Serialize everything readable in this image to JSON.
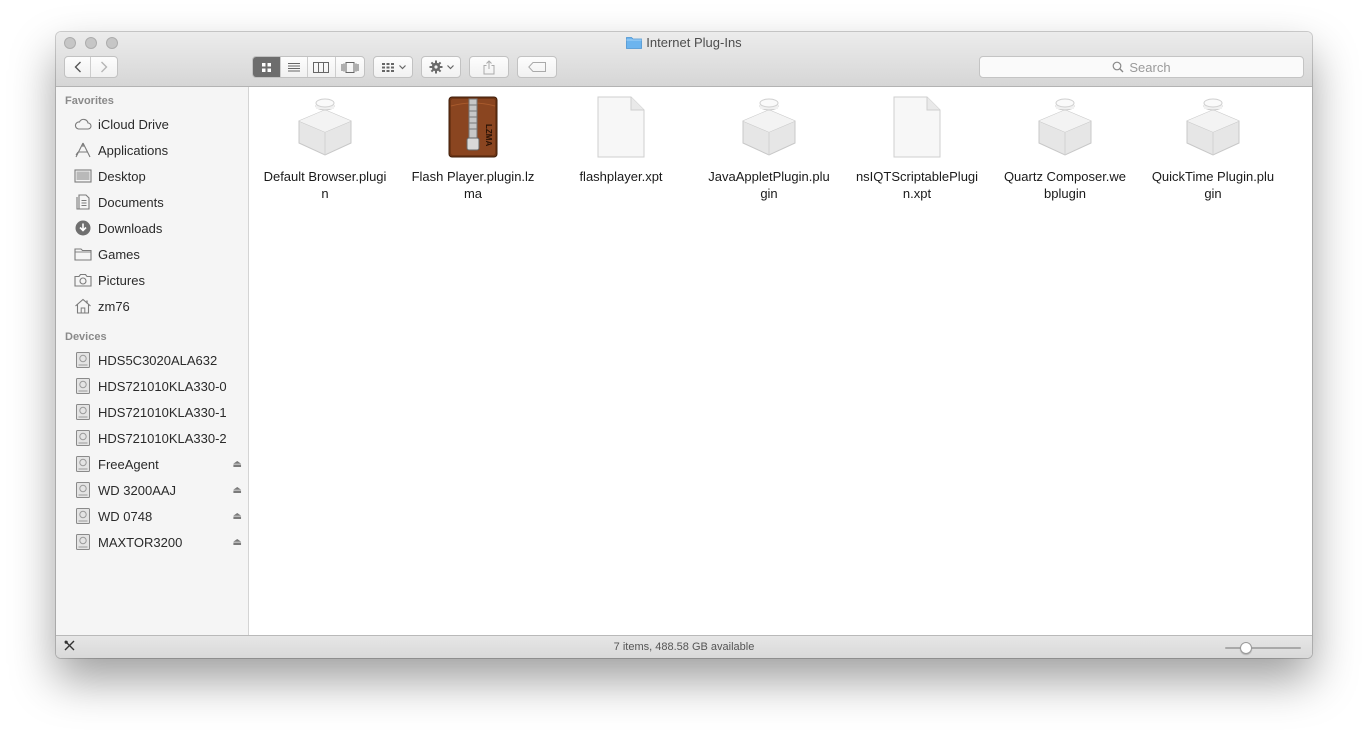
{
  "window": {
    "title": "Internet Plug-Ins",
    "search_placeholder": "Search"
  },
  "sidebar": {
    "favorites_header": "Favorites",
    "favorites": [
      {
        "label": "iCloud Drive",
        "icon": "cloud-icon"
      },
      {
        "label": "Applications",
        "icon": "applications-icon"
      },
      {
        "label": "Desktop",
        "icon": "desktop-icon"
      },
      {
        "label": "Documents",
        "icon": "documents-icon"
      },
      {
        "label": "Downloads",
        "icon": "downloads-icon"
      },
      {
        "label": "Games",
        "icon": "folder-icon"
      },
      {
        "label": "Pictures",
        "icon": "camera-icon"
      },
      {
        "label": "zm76",
        "icon": "home-icon"
      }
    ],
    "devices_header": "Devices",
    "devices": [
      {
        "label": "HDS5C3020ALA632",
        "ejectable": false
      },
      {
        "label": "HDS721010KLA330-0",
        "ejectable": false
      },
      {
        "label": "HDS721010KLA330-1",
        "ejectable": false
      },
      {
        "label": "HDS721010KLA330-2",
        "ejectable": false
      },
      {
        "label": "FreeAgent",
        "ejectable": true
      },
      {
        "label": "WD 3200AAJ",
        "ejectable": true
      },
      {
        "label": "WD 0748",
        "ejectable": true
      },
      {
        "label": "MAXTOR3200",
        "ejectable": true
      }
    ]
  },
  "files": [
    {
      "name": "Default Browser.plugin",
      "icon": "plugin-icon"
    },
    {
      "name": "Flash Player.plugin.lzma",
      "icon": "archive-icon"
    },
    {
      "name": "flashplayer.xpt",
      "icon": "document-icon"
    },
    {
      "name": "JavaAppletPlugin.plugin",
      "icon": "plugin-icon"
    },
    {
      "name": "nsIQTScriptablePlugin.xpt",
      "icon": "document-icon"
    },
    {
      "name": "Quartz Composer.webplugin",
      "icon": "plugin-icon"
    },
    {
      "name": "QuickTime Plugin.plugin",
      "icon": "plugin-icon"
    }
  ],
  "status": {
    "text": "7 items, 488.58 GB available",
    "icon_size_fraction": 0.27
  },
  "colors": {
    "folder_blue": "#6cb4ee",
    "selected_view": "#6d6d6d"
  }
}
